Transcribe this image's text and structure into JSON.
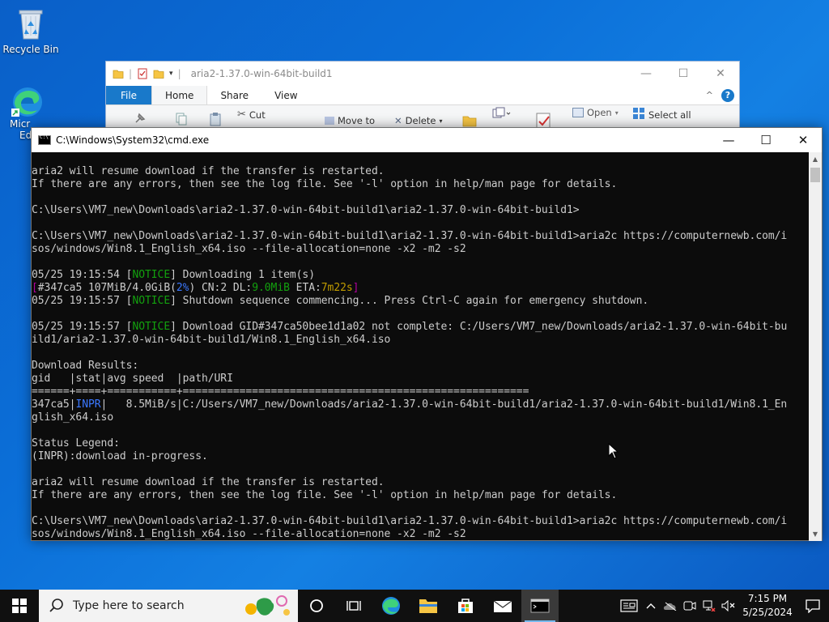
{
  "desktop": {
    "recycle_bin_label": "Recycle Bin",
    "edge_label_line1": "Micr",
    "edge_label_line2": "Ed"
  },
  "explorer": {
    "title": "aria2-1.37.0-win-64bit-build1",
    "tabs": [
      "File",
      "Home",
      "Share",
      "View"
    ],
    "ribbon": {
      "cut": "Cut",
      "move_to": "Move to",
      "delete": "Delete",
      "open": "Open",
      "select_all": "Select all"
    },
    "controls": {
      "minimize": "—",
      "maximize": "☐",
      "close": "✕",
      "help": "?",
      "collapse": "^"
    }
  },
  "cmd": {
    "title": "C:\\Windows\\System32\\cmd.exe",
    "controls": {
      "minimize": "—",
      "maximize": "☐",
      "close": "✕"
    },
    "lines": [
      {
        "text": "aria2 will resume download if the transfer is restarted."
      },
      {
        "text": "If there are any errors, then see the log file. See '-l' option in help/man page for details."
      },
      {
        "text": ""
      },
      {
        "text": "C:\\Users\\VM7_new\\Downloads\\aria2-1.37.0-win-64bit-build1\\aria2-1.37.0-win-64bit-build1>"
      },
      {
        "text": ""
      },
      {
        "text": "C:\\Users\\VM7_new\\Downloads\\aria2-1.37.0-win-64bit-build1\\aria2-1.37.0-win-64bit-build1>aria2c https://computernewb.com/i"
      },
      {
        "text": "sos/windows/Win8.1_English_x64.iso --file-allocation=none -x2 -m2 -s2"
      },
      {
        "text": ""
      },
      {
        "segments": [
          {
            "t": "05/25 19:15:54 ["
          },
          {
            "t": "NOTICE",
            "c": "g"
          },
          {
            "t": "] Downloading 1 item(s)"
          }
        ]
      },
      {
        "segments": [
          {
            "t": "[",
            "c": "mag"
          },
          {
            "t": "#347ca5 107MiB/4.0GiB("
          },
          {
            "t": "2%",
            "c": "b"
          },
          {
            "t": ") CN:2 DL:"
          },
          {
            "t": "9.0MiB",
            "c": "g"
          },
          {
            "t": " ETA:"
          },
          {
            "t": "7m22s",
            "c": "yel"
          },
          {
            "t": "]",
            "c": "mag"
          }
        ]
      },
      {
        "segments": [
          {
            "t": "05/25 19:15:57 ["
          },
          {
            "t": "NOTICE",
            "c": "g"
          },
          {
            "t": "] Shutdown sequence commencing... Press Ctrl-C again for emergency shutdown."
          }
        ]
      },
      {
        "text": ""
      },
      {
        "segments": [
          {
            "t": "05/25 19:15:57 ["
          },
          {
            "t": "NOTICE",
            "c": "g"
          },
          {
            "t": "] Download GID#347ca50bee1d1a02 not complete: C:/Users/VM7_new/Downloads/aria2-1.37.0-win-64bit-bu"
          }
        ]
      },
      {
        "text": "ild1/aria2-1.37.0-win-64bit-build1/Win8.1_English_x64.iso"
      },
      {
        "text": ""
      },
      {
        "text": "Download Results:"
      },
      {
        "text": "gid   |stat|avg speed  |path/URI"
      },
      {
        "text": "======+====+===========+======================================================="
      },
      {
        "segments": [
          {
            "t": "347ca5|"
          },
          {
            "t": "INPR",
            "c": "b"
          },
          {
            "t": "|   8.5MiB/s|C:/Users/VM7_new/Downloads/aria2-1.37.0-win-64bit-build1/aria2-1.37.0-win-64bit-build1/Win8.1_En"
          }
        ]
      },
      {
        "text": "glish_x64.iso"
      },
      {
        "text": ""
      },
      {
        "text": "Status Legend:"
      },
      {
        "text": "(INPR):download in-progress."
      },
      {
        "text": ""
      },
      {
        "text": "aria2 will resume download if the transfer is restarted."
      },
      {
        "text": "If there are any errors, then see the log file. See '-l' option in help/man page for details."
      },
      {
        "text": ""
      },
      {
        "text": "C:\\Users\\VM7_new\\Downloads\\aria2-1.37.0-win-64bit-build1\\aria2-1.37.0-win-64bit-build1>aria2c https://computernewb.com/i"
      },
      {
        "text": "sos/windows/Win8.1_English_x64.iso --file-allocation=none -x2 -m2 -s2"
      }
    ]
  },
  "taskbar": {
    "search_placeholder": "Type here to search",
    "clock_time": "7:15 PM",
    "clock_date": "5/25/2024"
  },
  "colors": {
    "notice": "#13a10e",
    "percent": "#3b78ff",
    "bracket": "#b4009e",
    "eta": "#c19c00",
    "console_bg": "#0c0c0c",
    "console_fg": "#cccccc"
  }
}
